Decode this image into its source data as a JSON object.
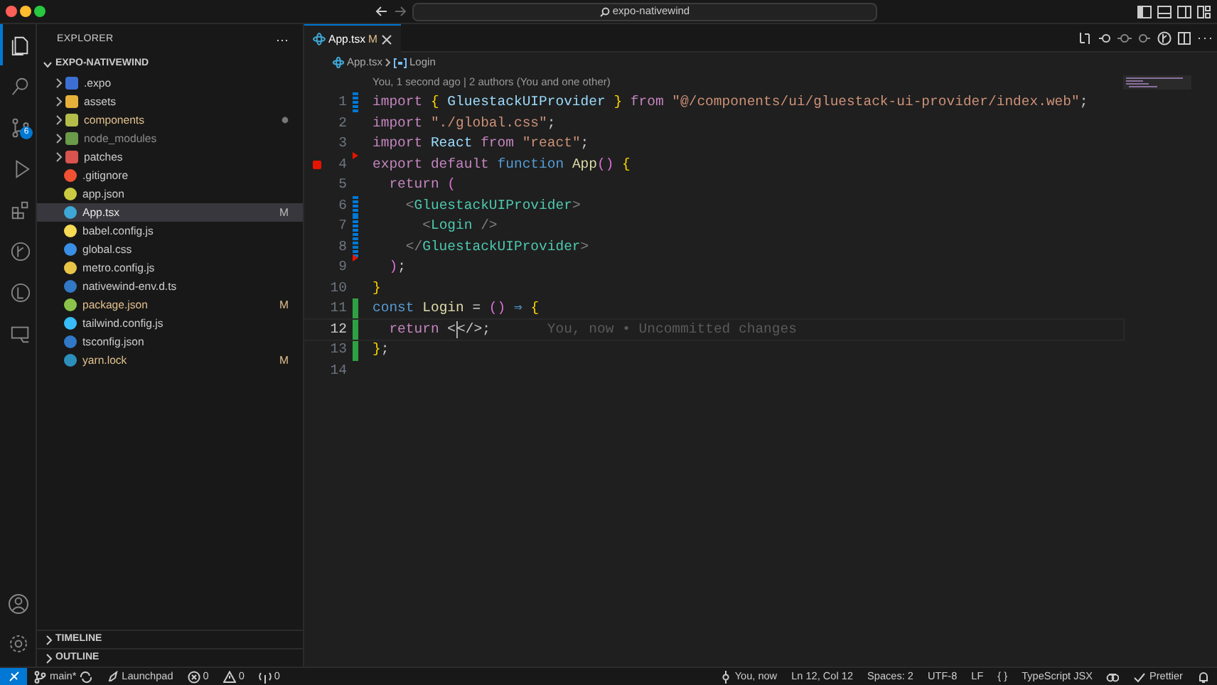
{
  "window": {
    "search": "expo-nativewind"
  },
  "activity_bar": {
    "items": [
      {
        "kind": "explorer",
        "selected": true
      },
      {
        "kind": "search",
        "selected": false
      },
      {
        "kind": "source-control",
        "selected": false,
        "badge": "6"
      },
      {
        "kind": "run",
        "selected": false
      },
      {
        "kind": "extensions",
        "selected": false
      },
      {
        "kind": "git-graph",
        "selected": false
      },
      {
        "kind": "git-lens",
        "selected": false
      },
      {
        "kind": "remote",
        "selected": false
      }
    ]
  },
  "sidebar": {
    "title": "EXPLORER",
    "project": "EXPO-NATIVEWIND",
    "items": [
      {
        "name": ".expo",
        "kind": "folder-expo",
        "modified": false,
        "ignored": false,
        "has_changes": false,
        "selected": false
      },
      {
        "name": "assets",
        "kind": "folder",
        "modified": false,
        "ignored": false,
        "has_changes": false,
        "selected": false
      },
      {
        "name": "components",
        "kind": "folder-components",
        "modified": true,
        "ignored": false,
        "has_changes": true,
        "selected": false
      },
      {
        "name": "node_modules",
        "kind": "folder-node",
        "modified": false,
        "ignored": true,
        "has_changes": false,
        "selected": false
      },
      {
        "name": "patches",
        "kind": "folder-patches",
        "modified": false,
        "ignored": false,
        "has_changes": false,
        "selected": false
      },
      {
        "name": ".gitignore",
        "kind": "git",
        "modified": false,
        "ignored": false,
        "has_changes": false,
        "selected": false
      },
      {
        "name": "app.json",
        "kind": "json",
        "modified": false,
        "ignored": false,
        "has_changes": false,
        "selected": false
      },
      {
        "name": "App.tsx",
        "kind": "react",
        "modified": true,
        "ignored": false,
        "has_changes": false,
        "badge": "M",
        "selected": true
      },
      {
        "name": "babel.config.js",
        "kind": "babel",
        "modified": false,
        "ignored": false,
        "has_changes": false,
        "selected": false
      },
      {
        "name": "global.css",
        "kind": "css",
        "modified": false,
        "ignored": false,
        "has_changes": false,
        "selected": false
      },
      {
        "name": "metro.config.js",
        "kind": "js",
        "modified": false,
        "ignored": false,
        "has_changes": false,
        "selected": false
      },
      {
        "name": "nativewind-env.d.ts",
        "kind": "ts",
        "modified": false,
        "ignored": false,
        "has_changes": false,
        "selected": false
      },
      {
        "name": "package.json",
        "kind": "npm",
        "modified": true,
        "ignored": false,
        "has_changes": false,
        "badge": "M",
        "selected": false
      },
      {
        "name": "tailwind.config.js",
        "kind": "tailwind",
        "modified": false,
        "ignored": false,
        "has_changes": false,
        "selected": false
      },
      {
        "name": "tsconfig.json",
        "kind": "tsconfig",
        "modified": false,
        "ignored": false,
        "has_changes": false,
        "selected": false
      },
      {
        "name": "yarn.lock",
        "kind": "yarn",
        "modified": true,
        "ignored": false,
        "has_changes": false,
        "badge": "M",
        "selected": false
      }
    ],
    "sections": [
      "TIMELINE",
      "OUTLINE"
    ]
  },
  "tabs": [
    {
      "label": "App.tsx",
      "badge": "M",
      "selected": true
    }
  ],
  "breadcrumb": [
    "App.tsx",
    "Login"
  ],
  "blame_header": "You, 1 second ago | 2 authors (You and one other)",
  "code": [
    {
      "n": "1",
      "kind": "modified",
      "breakpoint": false,
      "current": false,
      "tokens": [
        {
          "kind": "kw",
          "t": "import"
        },
        {
          "kind": "brace",
          "t": " {"
        },
        {
          "kind": "var",
          "t": " GluestackUIProvider "
        },
        {
          "kind": "brace",
          "t": "}"
        },
        {
          "kind": "kw",
          "t": " from "
        },
        {
          "kind": "str",
          "t": "\"@/components/ui/gluestack-ui-provider/index.web\""
        },
        {
          "kind": "p",
          "t": ";"
        }
      ]
    },
    {
      "n": "2",
      "kind": "plain",
      "breakpoint": false,
      "current": false,
      "tokens": [
        {
          "kind": "kw",
          "t": "import"
        },
        {
          "kind": "str",
          "t": " \"./global.css\""
        },
        {
          "kind": "p",
          "t": ";"
        }
      ]
    },
    {
      "n": "3",
      "kind": "plain",
      "breakpoint": false,
      "current": false,
      "tokens": [
        {
          "kind": "kw",
          "t": "import"
        },
        {
          "kind": "var",
          "t": " React"
        },
        {
          "kind": "kw",
          "t": " from"
        },
        {
          "kind": "str",
          "t": " \"react\""
        },
        {
          "kind": "p",
          "t": ";"
        }
      ]
    },
    {
      "n": "4",
      "kind": "deleted",
      "breakpoint": true,
      "current": false,
      "tokens": [
        {
          "kind": "kw",
          "t": "export default"
        },
        {
          "kind": "decl",
          "t": " function"
        },
        {
          "kind": "fn",
          "t": " App"
        },
        {
          "kind": "paren",
          "t": "()"
        },
        {
          "kind": "brace",
          "t": " {"
        }
      ]
    },
    {
      "n": "5",
      "kind": "plain",
      "breakpoint": false,
      "current": false,
      "tokens": [
        {
          "kind": "kw",
          "t": "  return"
        },
        {
          "kind": "paren",
          "t": " ("
        }
      ]
    },
    {
      "n": "6",
      "kind": "modified",
      "breakpoint": false,
      "current": false,
      "tokens": [
        {
          "kind": "tagp",
          "t": "    <"
        },
        {
          "kind": "tag",
          "t": "GluestackUIProvider"
        },
        {
          "kind": "tagp",
          "t": ">"
        }
      ]
    },
    {
      "n": "7",
      "kind": "modified",
      "breakpoint": false,
      "current": false,
      "tokens": [
        {
          "kind": "tagp",
          "t": "      <"
        },
        {
          "kind": "tag",
          "t": "Login"
        },
        {
          "kind": "tagp",
          "t": " />"
        }
      ]
    },
    {
      "n": "8",
      "kind": "modified",
      "breakpoint": false,
      "current": false,
      "tokens": [
        {
          "kind": "tagp",
          "t": "    </"
        },
        {
          "kind": "tag",
          "t": "GluestackUIProvider"
        },
        {
          "kind": "tagp",
          "t": ">"
        }
      ]
    },
    {
      "n": "9",
      "kind": "deleted",
      "breakpoint": false,
      "current": false,
      "tokens": [
        {
          "kind": "paren",
          "t": "  )"
        },
        {
          "kind": "p",
          "t": ";"
        }
      ]
    },
    {
      "n": "10",
      "kind": "plain",
      "breakpoint": false,
      "current": false,
      "tokens": [
        {
          "kind": "brace",
          "t": "}"
        }
      ]
    },
    {
      "n": "11",
      "kind": "added",
      "breakpoint": false,
      "current": false,
      "tokens": [
        {
          "kind": "decl",
          "t": "const"
        },
        {
          "kind": "fn",
          "t": " Login"
        },
        {
          "kind": "p",
          "t": " ="
        },
        {
          "kind": "paren",
          "t": " ()"
        },
        {
          "kind": "decl",
          "t": " ⇒"
        },
        {
          "kind": "brace",
          "t": " {"
        }
      ]
    },
    {
      "n": "12",
      "kind": "added",
      "breakpoint": false,
      "current": true,
      "blame": "You, now • Uncommitted changes",
      "tokens": [
        {
          "kind": "kw",
          "t": "  return"
        },
        {
          "kind": "p",
          "t": " <"
        },
        {
          "kind": "cursor"
        },
        {
          "kind": "p",
          "t": "</>;"
        }
      ]
    },
    {
      "n": "13",
      "kind": "added",
      "breakpoint": false,
      "current": false,
      "tokens": [
        {
          "kind": "brace",
          "t": "}"
        },
        {
          "kind": "p",
          "t": ";"
        }
      ]
    },
    {
      "n": "14",
      "kind": "plain",
      "breakpoint": false,
      "current": false
    }
  ],
  "status_bar": {
    "left": [
      {
        "kind": "branch",
        "text": "main*"
      },
      {
        "kind": "launchpad",
        "text": "Launchpad"
      },
      {
        "kind": "errors",
        "text": "0"
      },
      {
        "kind": "warnings",
        "text": "0"
      },
      {
        "kind": "ports",
        "text": "0"
      }
    ],
    "right": [
      {
        "kind": "blame",
        "text": "You, now"
      },
      {
        "kind": "plain",
        "text": "Ln 12, Col 12"
      },
      {
        "kind": "plain",
        "text": "Spaces: 2"
      },
      {
        "kind": "plain",
        "text": "UTF-8"
      },
      {
        "kind": "plain",
        "text": "LF"
      },
      {
        "kind": "plain",
        "text": "{ }"
      },
      {
        "kind": "plain",
        "text": "TypeScript JSX"
      },
      {
        "kind": "copilot"
      },
      {
        "kind": "check",
        "text": "Prettier"
      },
      {
        "kind": "bell"
      }
    ]
  }
}
